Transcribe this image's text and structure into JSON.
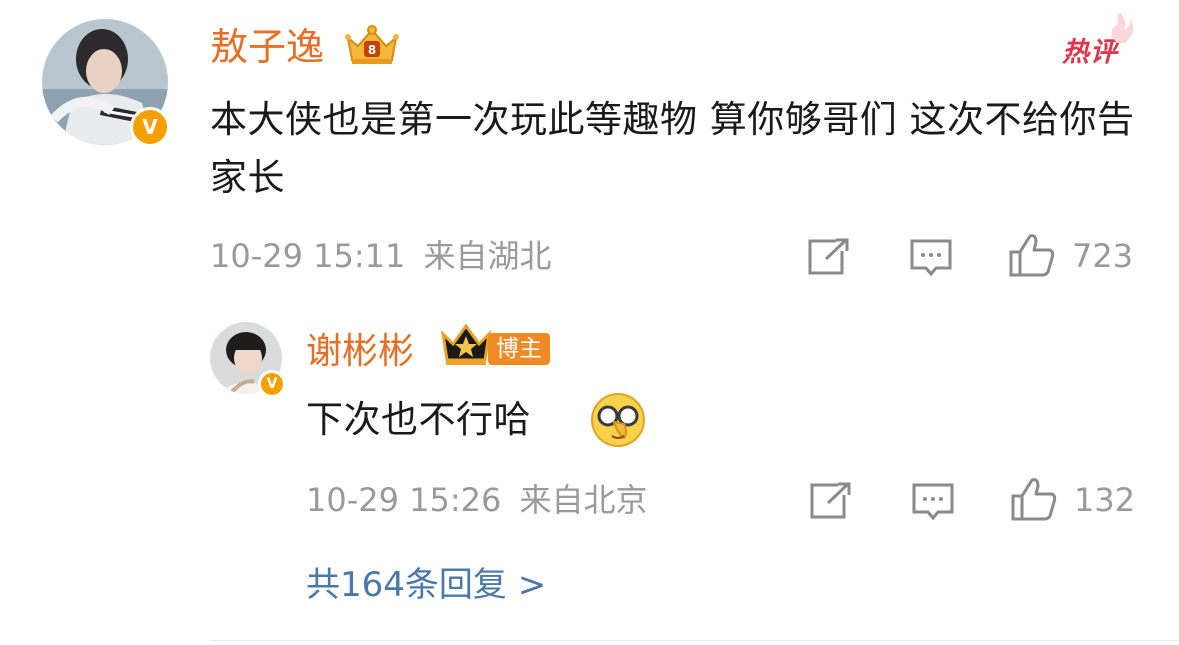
{
  "comment": {
    "username": "敖子逸",
    "hot_label": "热评",
    "content": "本大侠也是第一次玩此等趣物 算你够哥们 这次不给你告家长",
    "time": "10-29 15:11",
    "location": "来自湖北",
    "likes": "723",
    "icons": [
      "crown-badge-icon",
      "verified-v-icon",
      "share-icon",
      "comment-icon",
      "like-icon"
    ]
  },
  "reply": {
    "username": "谢彬彬",
    "badge": "博主",
    "content": "下次也不行哈",
    "emoji": "glasses-emoji-icon",
    "time": "10-29 15:26",
    "location": "来自北京",
    "likes": "132"
  },
  "more_replies": "共164条回复 >",
  "colors": {
    "username": "#e86e24",
    "link": "#4a78a8",
    "meta": "#9a9a9a",
    "verified": "#f5a000",
    "hot": "#e2354b"
  }
}
